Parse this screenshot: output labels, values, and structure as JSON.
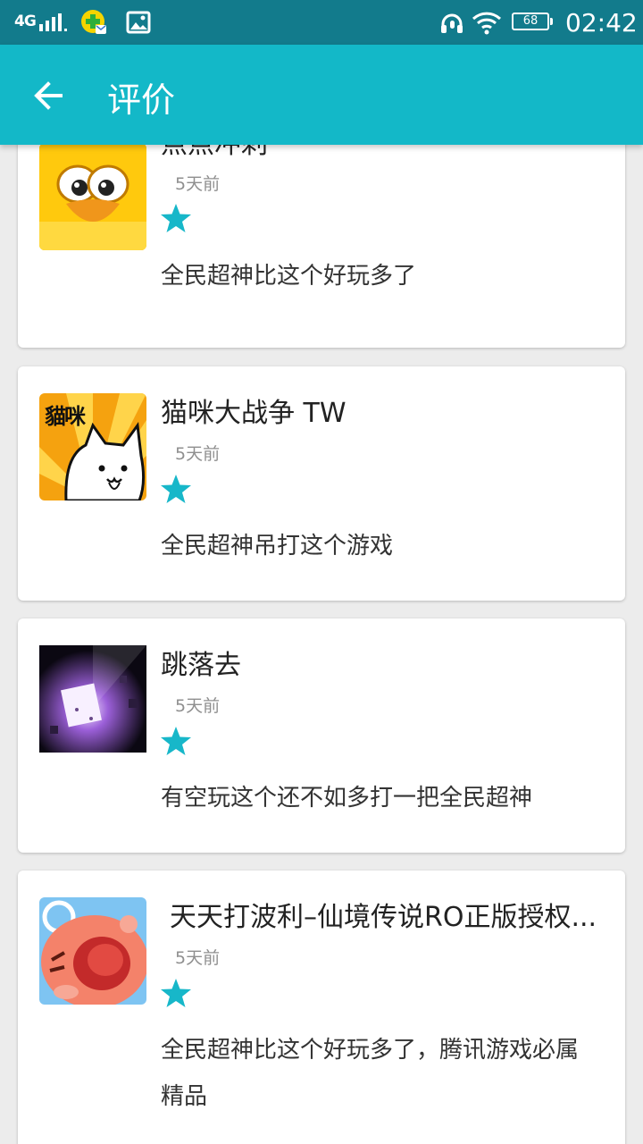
{
  "status_bar": {
    "network": "4G",
    "battery": "68",
    "time": "02:42",
    "icons": [
      "signal-icon",
      "app-notification-icon",
      "image-icon",
      "headset-icon",
      "wifi-icon",
      "battery-icon"
    ]
  },
  "app_bar": {
    "title": "评价",
    "back_icon": "arrow-left-icon"
  },
  "colors": {
    "status_bar": "#127b8c",
    "app_bar": "#13b8c8",
    "star": "#17b7c9",
    "background": "#ececec"
  },
  "reviews": [
    {
      "app_name": "点点冲刺",
      "time": "5天前",
      "stars": 1,
      "comment": "全民超神比这个好玩多了",
      "icon": "duck-face-icon"
    },
    {
      "app_name": "猫咪大战争 TW",
      "time": "5天前",
      "stars": 1,
      "comment": "全民超神吊打这个游戏",
      "icon": "cat-icon",
      "icon_text": "貓咪"
    },
    {
      "app_name": "跳落去",
      "time": "5天前",
      "stars": 1,
      "comment": "有空玩这个还不如多打一把全民超神",
      "icon": "glowing-cube-icon"
    },
    {
      "app_name": "天天打波利–仙境传说RO正版授权...",
      "time": "5天前",
      "stars": 1,
      "comment": "全民超神比这个好玩多了，腾讯游戏必属精品",
      "icon": "poring-icon"
    }
  ]
}
